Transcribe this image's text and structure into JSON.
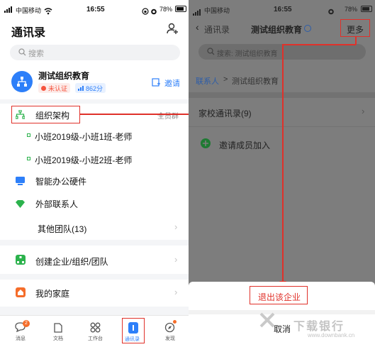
{
  "left": {
    "status": {
      "carrier": "中国移动",
      "time": "16:55",
      "battery": "78%"
    },
    "header": {
      "title": "通讯录"
    },
    "search": {
      "placeholder": "搜索"
    },
    "org": {
      "name": "测试组织教育",
      "badge_unverified": "未认证",
      "badge_score": "862分",
      "invite": "邀请"
    },
    "structure": {
      "label": "组织架构",
      "all_staff": "全员群"
    },
    "classes": [
      {
        "label": "小班2019级-小班1班-老师"
      },
      {
        "label": "小班2019级-小班2班-老师"
      }
    ],
    "items": {
      "hardware": "智能办公硬件",
      "external": "外部联系人",
      "other_teams": "其他团队(13)",
      "create": "创建企业/组织/团队",
      "family": "我的家庭"
    },
    "tabs": [
      {
        "label": "消息",
        "badge": "2"
      },
      {
        "label": "文档"
      },
      {
        "label": "工作台"
      },
      {
        "label": "通讯录"
      },
      {
        "label": "发现"
      }
    ]
  },
  "right": {
    "status": {
      "carrier": "中国移动",
      "time": "16:55",
      "battery": "78%"
    },
    "nav": {
      "back": "通讯录",
      "title": "测试组织教育",
      "more": "更多"
    },
    "search": {
      "placeholder": "搜索: 测试组织教育"
    },
    "breadcrumb": {
      "root": "联系人",
      "sep": ">",
      "current": "测试组织教育"
    },
    "group": {
      "label": "家校通讯录(9)"
    },
    "invite": {
      "label": "邀请成员加入"
    },
    "sheet": {
      "exit": "退出该企业",
      "cancel": "取消"
    }
  },
  "watermark": {
    "brand": "下载银行",
    "url": "www.downbank.cn"
  },
  "colors": {
    "accent": "#2d7ff9",
    "highlight": "#e0312a",
    "green": "#2bb24c",
    "orange": "#f56d2a"
  }
}
